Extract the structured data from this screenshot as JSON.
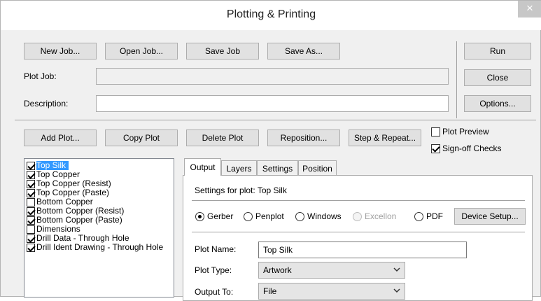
{
  "window": {
    "title": "Plotting & Printing",
    "close_glyph": "×"
  },
  "job_toolbar": {
    "new_job": "New Job...",
    "open_job": "Open Job...",
    "save_job": "Save Job",
    "save_as": "Save As..."
  },
  "side_buttons": {
    "run": "Run",
    "close": "Close",
    "options": "Options..."
  },
  "fields": {
    "plot_job_label": "Plot Job:",
    "plot_job_value": "",
    "description_label": "Description:",
    "description_value": ""
  },
  "plot_toolbar": {
    "add_plot": "Add Plot...",
    "copy_plot": "Copy Plot",
    "delete_plot": "Delete Plot",
    "reposition": "Reposition...",
    "step_repeat": "Step & Repeat..."
  },
  "options": [
    {
      "label": "Plot Preview",
      "checked": false
    },
    {
      "label": "Sign-off Checks",
      "checked": true
    }
  ],
  "plot_list": [
    {
      "label": "Top Silk",
      "checked": true,
      "selected": true
    },
    {
      "label": "Top Copper",
      "checked": true
    },
    {
      "label": "Top Copper (Resist)",
      "checked": true
    },
    {
      "label": "Top Copper (Paste)",
      "checked": true
    },
    {
      "label": "Bottom Copper",
      "checked": false
    },
    {
      "label": "Bottom Copper (Resist)",
      "checked": true
    },
    {
      "label": "Bottom Copper (Paste)",
      "checked": true
    },
    {
      "label": "Dimensions",
      "checked": false
    },
    {
      "label": "Drill Data - Through Hole",
      "checked": true
    },
    {
      "label": "Drill Ident Drawing - Through Hole",
      "checked": true
    }
  ],
  "tabs": [
    {
      "label": "Output",
      "active": true
    },
    {
      "label": "Layers"
    },
    {
      "label": "Settings"
    },
    {
      "label": "Position"
    }
  ],
  "output_panel": {
    "heading": "Settings for plot: Top Silk",
    "formats": [
      {
        "label": "Gerber",
        "selected": true,
        "enabled": true
      },
      {
        "label": "Penplot",
        "selected": false,
        "enabled": true
      },
      {
        "label": "Windows",
        "selected": false,
        "enabled": true
      },
      {
        "label": "Excellon",
        "selected": false,
        "enabled": false
      },
      {
        "label": "PDF",
        "selected": false,
        "enabled": true
      }
    ],
    "device_setup": "Device Setup...",
    "plot_name_label": "Plot Name:",
    "plot_name_value": "Top Silk",
    "plot_type_label": "Plot Type:",
    "plot_type_value": "Artwork",
    "output_to_label": "Output To:",
    "output_to_value": "File"
  }
}
